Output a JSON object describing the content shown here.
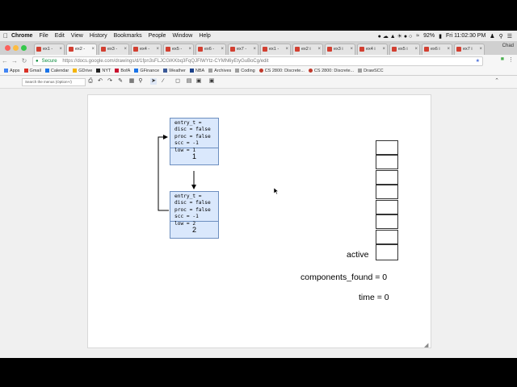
{
  "menubar": {
    "app": "Chrome",
    "items": [
      "File",
      "Edit",
      "View",
      "History",
      "Bookmarks",
      "People",
      "Window",
      "Help"
    ],
    "battery": "92%",
    "clock": "Fri 11:02:30 PM"
  },
  "tabs": [
    {
      "label": "ex1 -"
    },
    {
      "label": "ex2 -"
    },
    {
      "label": "ex3 -"
    },
    {
      "label": "ex4 -"
    },
    {
      "label": "ex5 -"
    },
    {
      "label": "ex6 -"
    },
    {
      "label": "ex7 -"
    },
    {
      "label": "ex1 -"
    },
    {
      "label": "ex2 i"
    },
    {
      "label": "ex3 i"
    },
    {
      "label": "ex4 i"
    },
    {
      "label": "ex5 i"
    },
    {
      "label": "ex6 i"
    },
    {
      "label": "ex7 i"
    }
  ],
  "user_name": "Chad",
  "address": {
    "secure_label": "Secure",
    "url": "https://docs.google.com/drawings/d/1fpn3sFLJCGlKKbq3FqQJFlWYtz-CYMN6yEtyGuBoCg/edit"
  },
  "bookmarks": [
    {
      "label": "Apps"
    },
    {
      "label": "Gmail"
    },
    {
      "label": "Calendar"
    },
    {
      "label": "GDrive"
    },
    {
      "label": "NYT"
    },
    {
      "label": "BofA"
    },
    {
      "label": "GFinance"
    },
    {
      "label": "Weather"
    },
    {
      "label": "NBA"
    },
    {
      "label": "Archives"
    },
    {
      "label": "Coding"
    },
    {
      "label": "CS 2800: Discrete..."
    },
    {
      "label": "CS 2800: Discrete..."
    },
    {
      "label": "DrawSCC"
    }
  ],
  "toolbar": {
    "search_placeholder": "Search the menus (Option+/)"
  },
  "diagram": {
    "nodes": [
      {
        "fields": "entry_t =\ndisc = false\nproc = false\nscc = -1\nlow = 1",
        "id": "1"
      },
      {
        "fields": "entry_t =\ndisc = false\nproc = false\nscc = -1\nlow = 2",
        "id": "2"
      }
    ],
    "active_label": "active",
    "components_found_label": "components_found  = 0",
    "time_label": "time  = 0"
  }
}
